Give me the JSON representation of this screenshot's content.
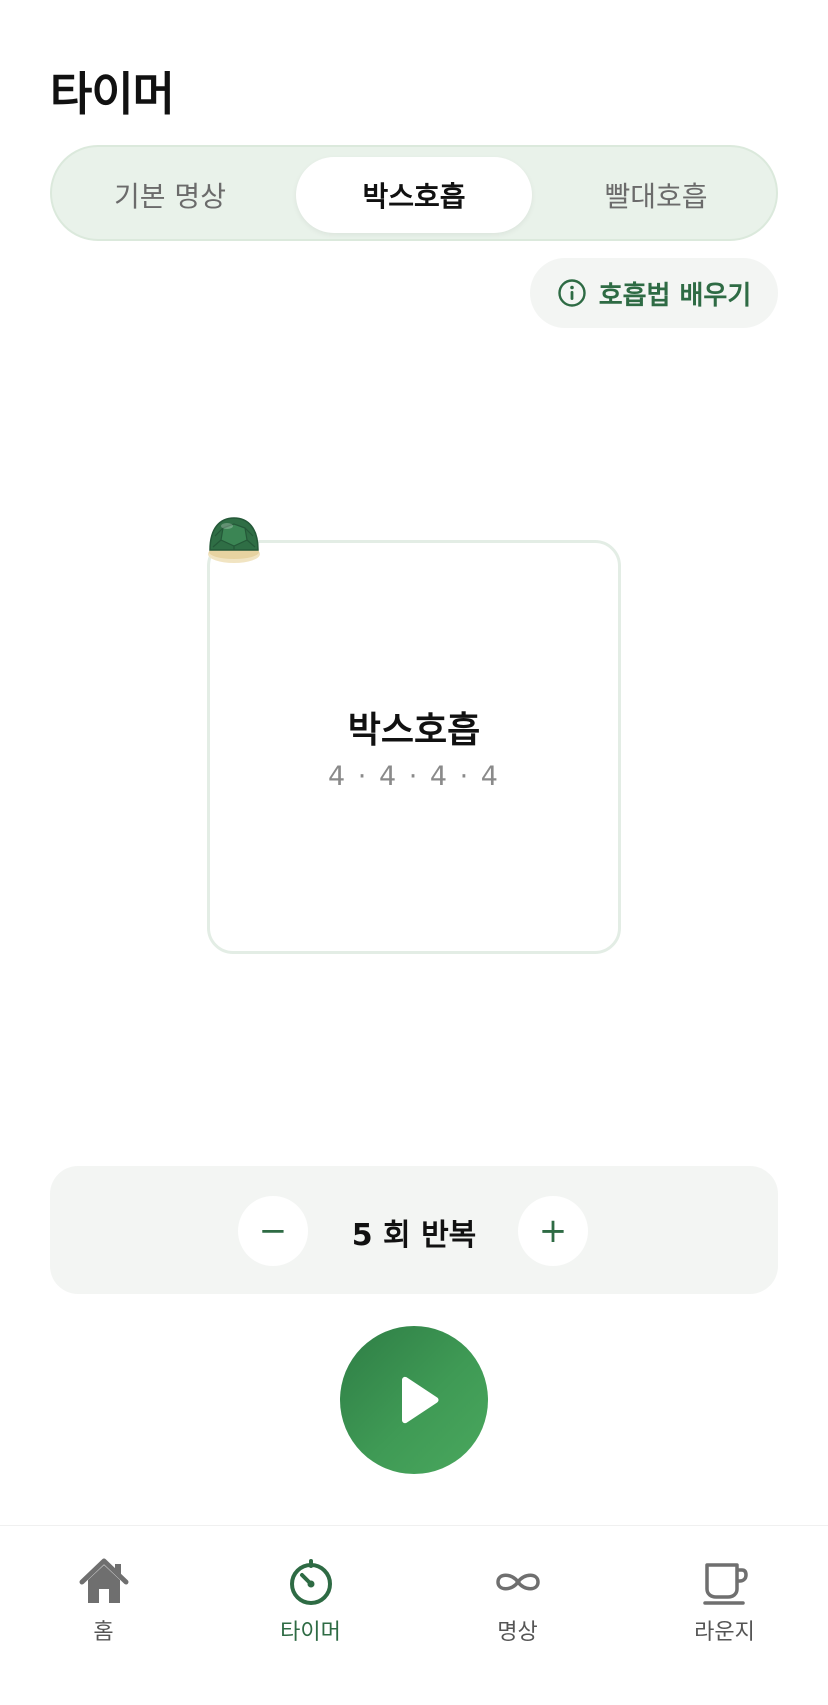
{
  "header": {
    "title": "타이머"
  },
  "segments": [
    {
      "label": "기본 명상",
      "selected": false
    },
    {
      "label": "박스호흡",
      "selected": true
    },
    {
      "label": "빨대호흡",
      "selected": false
    }
  ],
  "learn_button": {
    "label": "호흡법 배우기",
    "icon": "info-icon"
  },
  "breath_box": {
    "title": "박스호흡",
    "pattern": "4 · 4 · 4 · 4"
  },
  "repeat": {
    "label": "5 회 반복",
    "minus": "−",
    "plus": "+"
  },
  "play_button": {
    "icon": "play-icon"
  },
  "tabbar": {
    "items": [
      {
        "label": "홈",
        "icon": "home-icon"
      },
      {
        "label": "타이머",
        "icon": "timer-icon",
        "active": true
      },
      {
        "label": "명상",
        "icon": "infinity-icon"
      },
      {
        "label": "라운지",
        "icon": "cup-icon"
      }
    ]
  },
  "colors": {
    "accent": "#2e6b44",
    "play_gradient_start": "#2e7d45",
    "play_gradient_end": "#4aa85e",
    "segment_bg": "#e9f2ea"
  }
}
